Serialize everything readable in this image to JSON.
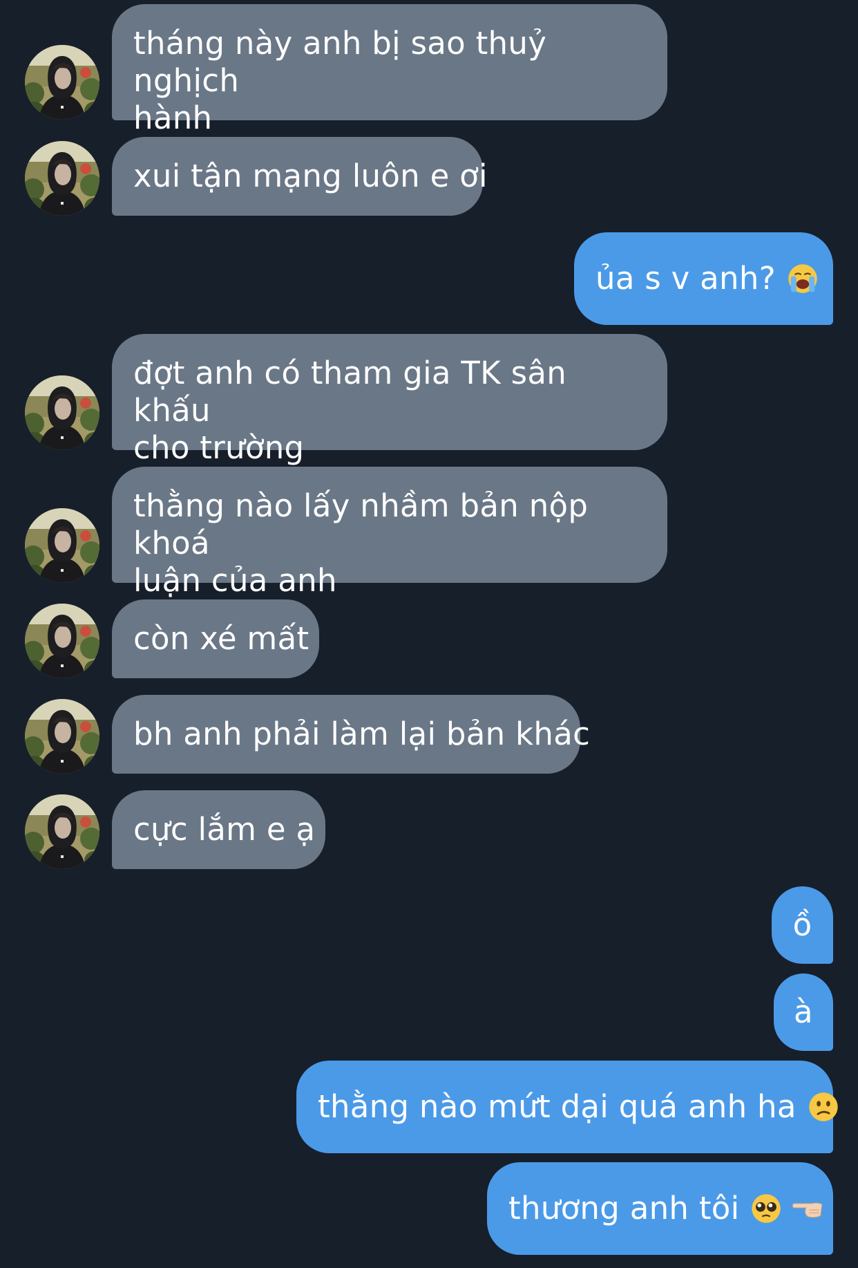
{
  "conversation": {
    "messages": [
      {
        "direction": "incoming",
        "text": "tháng này anh bị sao thuỷ nghịch\nhành",
        "avatar": "contact-avatar"
      },
      {
        "direction": "incoming",
        "text": "xui tận mạng luôn e ơi",
        "avatar": "contact-avatar"
      },
      {
        "direction": "outgoing",
        "text": "ủa s v anh?",
        "emoji": "loudly-crying-face"
      },
      {
        "direction": "incoming",
        "text": "đợt anh có tham gia TK sân khấu\ncho trường",
        "avatar": "contact-avatar"
      },
      {
        "direction": "incoming",
        "text": "thằng nào lấy nhầm bản nộp khoá\nluận của anh",
        "avatar": "contact-avatar"
      },
      {
        "direction": "incoming",
        "text": "còn xé mất",
        "avatar": "contact-avatar"
      },
      {
        "direction": "incoming",
        "text": "bh anh phải làm lại bản khác",
        "avatar": "contact-avatar"
      },
      {
        "direction": "incoming",
        "text": "cực lắm e ạ",
        "avatar": "contact-avatar"
      },
      {
        "direction": "outgoing",
        "text": "ồ"
      },
      {
        "direction": "outgoing",
        "text": "à"
      },
      {
        "direction": "outgoing",
        "text": "thằng nào mứt dại quá anh ha",
        "emoji": "confused-face"
      },
      {
        "direction": "outgoing",
        "text": "thương anh tôi",
        "emoji": "pleading-face",
        "emoji2": "backhand-index-pointing-left"
      }
    ]
  },
  "colors": {
    "background": "#171f2b",
    "incoming_bubble": "#6a7787",
    "outgoing_bubble": "#4b9ae8",
    "text": "#ffffff"
  }
}
